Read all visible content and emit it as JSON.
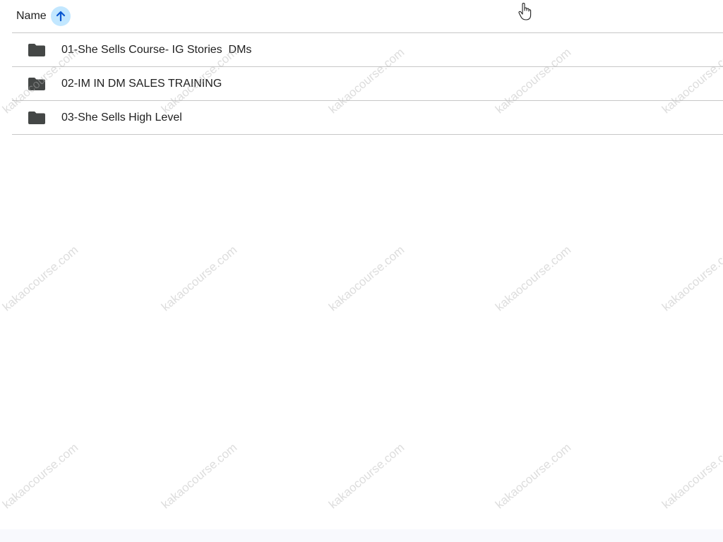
{
  "header": {
    "column_label": "Name",
    "sort_icon": "arrow-up-icon"
  },
  "files": [
    {
      "name": "01-She Sells Course- IG Stories  DMs",
      "icon": "folder-icon"
    },
    {
      "name": "02-IM IN DM SALES TRAINING",
      "icon": "folder-icon"
    },
    {
      "name": "03-She Sells High Level",
      "icon": "folder-icon"
    }
  ],
  "watermark": {
    "text": "kakaocourse.com"
  },
  "colors": {
    "sort_badge": "#c2e7ff",
    "sort_arrow": "#0b57d0",
    "folder": "#444746",
    "divider": "#c7c7c7"
  }
}
